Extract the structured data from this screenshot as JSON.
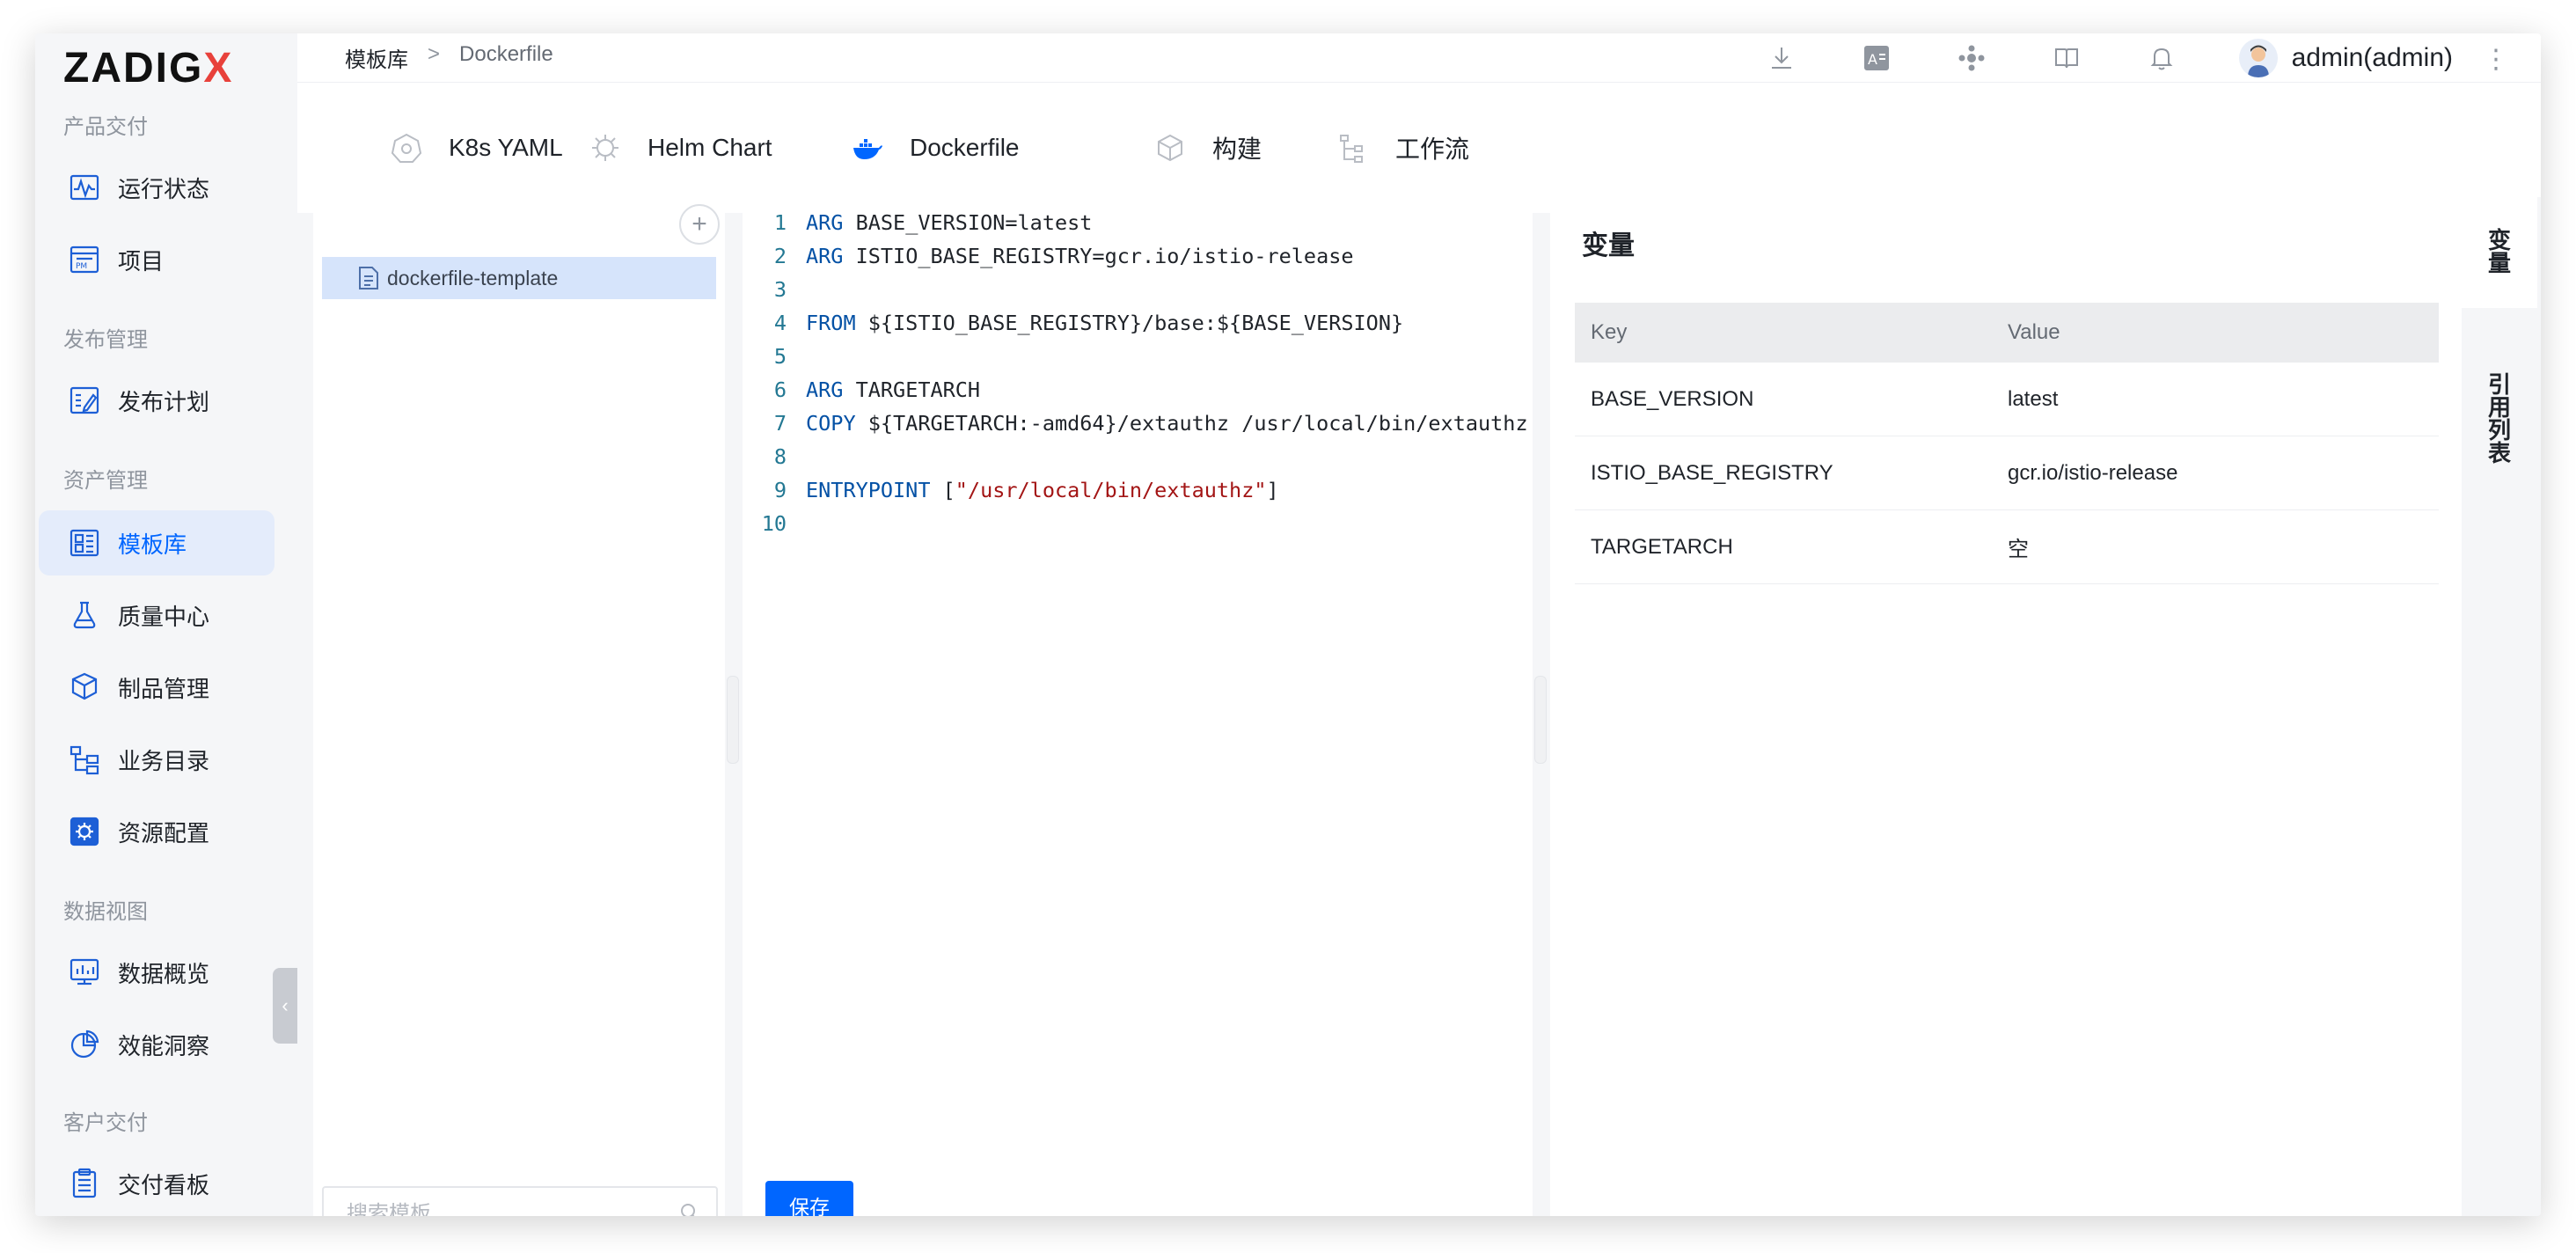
{
  "app": {
    "logo_main": "ZADIG",
    "logo_x": "X"
  },
  "sidebar": {
    "sections": [
      {
        "title": "产品交付"
      },
      {
        "title": "发布管理"
      },
      {
        "title": "资产管理"
      },
      {
        "title": "数据视图"
      },
      {
        "title": "客户交付"
      }
    ],
    "items": [
      {
        "label": "运行状态",
        "icon": "pulse-icon"
      },
      {
        "label": "项目",
        "icon": "project-icon"
      },
      {
        "label": "发布计划",
        "icon": "release-plan-icon"
      },
      {
        "label": "模板库",
        "icon": "template-icon",
        "active": true
      },
      {
        "label": "质量中心",
        "icon": "flask-icon"
      },
      {
        "label": "制品管理",
        "icon": "package-icon"
      },
      {
        "label": "业务目录",
        "icon": "catalog-icon"
      },
      {
        "label": "资源配置",
        "icon": "gear-icon"
      },
      {
        "label": "数据概览",
        "icon": "chart-monitor-icon"
      },
      {
        "label": "效能洞察",
        "icon": "pie-icon"
      },
      {
        "label": "交付看板",
        "icon": "clipboard-icon"
      }
    ]
  },
  "header": {
    "breadcrumb_root": "模板库",
    "breadcrumb_sep": ">",
    "breadcrumb_current": "Dockerfile",
    "user": "admin(admin)"
  },
  "tabs": [
    {
      "label": "K8s YAML"
    },
    {
      "label": "Helm Chart"
    },
    {
      "label": "Dockerfile",
      "active": true
    },
    {
      "label": "构建"
    },
    {
      "label": "工作流"
    }
  ],
  "file_panel": {
    "add_symbol": "+",
    "files": [
      {
        "name": "dockerfile-template",
        "selected": true
      }
    ],
    "search_placeholder": "搜索模板"
  },
  "editor": {
    "lines": [
      {
        "n": "1",
        "kw": "ARG",
        "rest": " BASE_VERSION=latest",
        "str": "",
        "tail": ""
      },
      {
        "n": "2",
        "kw": "ARG",
        "rest": " ISTIO_BASE_REGISTRY=gcr.io/istio-release",
        "str": "",
        "tail": ""
      },
      {
        "n": "3",
        "kw": "",
        "rest": "",
        "str": "",
        "tail": ""
      },
      {
        "n": "4",
        "kw": "FROM",
        "rest": " ${ISTIO_BASE_REGISTRY}/base:${BASE_VERSION}",
        "str": "",
        "tail": ""
      },
      {
        "n": "5",
        "kw": "",
        "rest": "",
        "str": "",
        "tail": ""
      },
      {
        "n": "6",
        "kw": "ARG",
        "rest": " TARGETARCH",
        "str": "",
        "tail": ""
      },
      {
        "n": "7",
        "kw": "COPY",
        "rest": " ${TARGETARCH:-amd64}/extauthz /usr/local/bin/extauthz",
        "str": "",
        "tail": ""
      },
      {
        "n": "8",
        "kw": "",
        "rest": "",
        "str": "",
        "tail": ""
      },
      {
        "n": "9",
        "kw": "ENTRYPOINT",
        "rest": " [",
        "str": "\"/usr/local/bin/extauthz\"",
        "tail": "]"
      },
      {
        "n": "10",
        "kw": "",
        "rest": "",
        "str": "",
        "tail": ""
      }
    ],
    "save_label": "保存"
  },
  "variables": {
    "title": "变量",
    "col_key": "Key",
    "col_value": "Value",
    "rows": [
      {
        "key": "BASE_VERSION",
        "value": "latest"
      },
      {
        "key": "ISTIO_BASE_REGISTRY",
        "value": "gcr.io/istio-release"
      },
      {
        "key": "TARGETARCH",
        "value": "空"
      }
    ]
  },
  "side_tabs": [
    {
      "label": "变量",
      "chars": [
        "变",
        "量"
      ],
      "active": true
    },
    {
      "label": "引用列表",
      "chars": [
        "引",
        "用",
        "列",
        "表"
      ]
    }
  ],
  "colors": {
    "accent": "#0066ff",
    "logo_x": "#e8413b",
    "active_bg": "#e4ecfb"
  }
}
